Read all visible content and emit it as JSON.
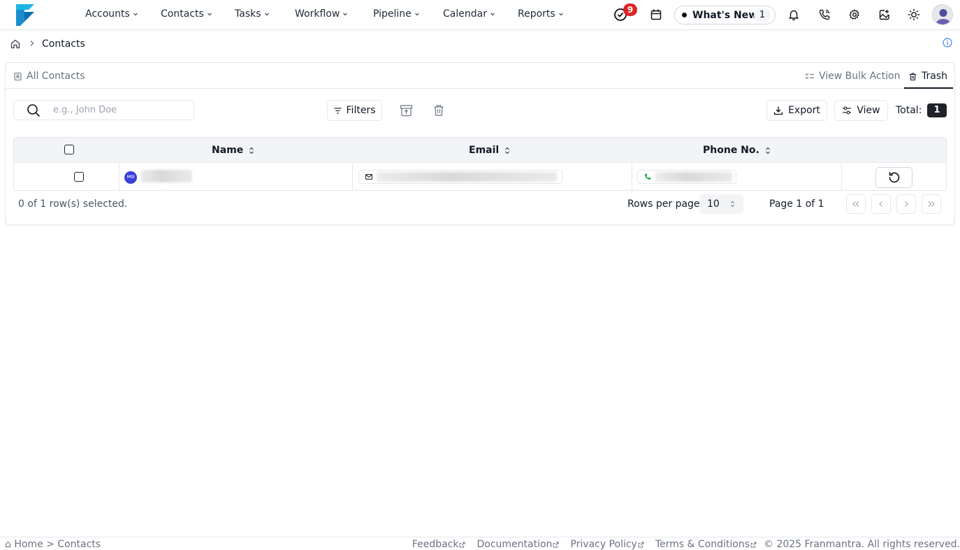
{
  "nav": {
    "menu": [
      {
        "label": "Accounts"
      },
      {
        "label": "Contacts"
      },
      {
        "label": "Tasks"
      },
      {
        "label": "Workflow"
      },
      {
        "label": "Pipeline"
      },
      {
        "label": "Calendar"
      },
      {
        "label": "Reports"
      }
    ],
    "notification_badge": "9",
    "whats_new": {
      "label": "What's New",
      "count": "1"
    }
  },
  "breadcrumb": {
    "current": "Contacts"
  },
  "card": {
    "tab_all": "All Contacts",
    "tab_bulk": "View Bulk Action",
    "tab_trash": "Trash",
    "search_placeholder": "e.g., John Doe",
    "filters_label": "Filters",
    "export_label": "Export",
    "view_label": "View",
    "total_label": "Total:",
    "total_value": "1"
  },
  "table": {
    "columns": [
      "Name",
      "Email",
      "Phone No."
    ],
    "rows": [
      {
        "avatar_initials": "MD"
      }
    ]
  },
  "pagination": {
    "selected_text": "0 of 1 row(s) selected.",
    "rows_per_page_label": "Rows per page",
    "rows_per_page_value": "10",
    "page_text": "Page 1 of 1"
  },
  "footer": {
    "crumb": "⌂ Home >  Contacts",
    "links": [
      "Feedback",
      "Documentation",
      "Privacy Policy",
      "Terms & Conditions"
    ],
    "copyright": "© 2025 Franmantra. All rights reserved."
  },
  "colors": {
    "brand_blue": "#1eb4e6",
    "badge_red": "#dc2626",
    "avatar_blue": "#3b3fd9",
    "phone_green": "#16a34a"
  }
}
